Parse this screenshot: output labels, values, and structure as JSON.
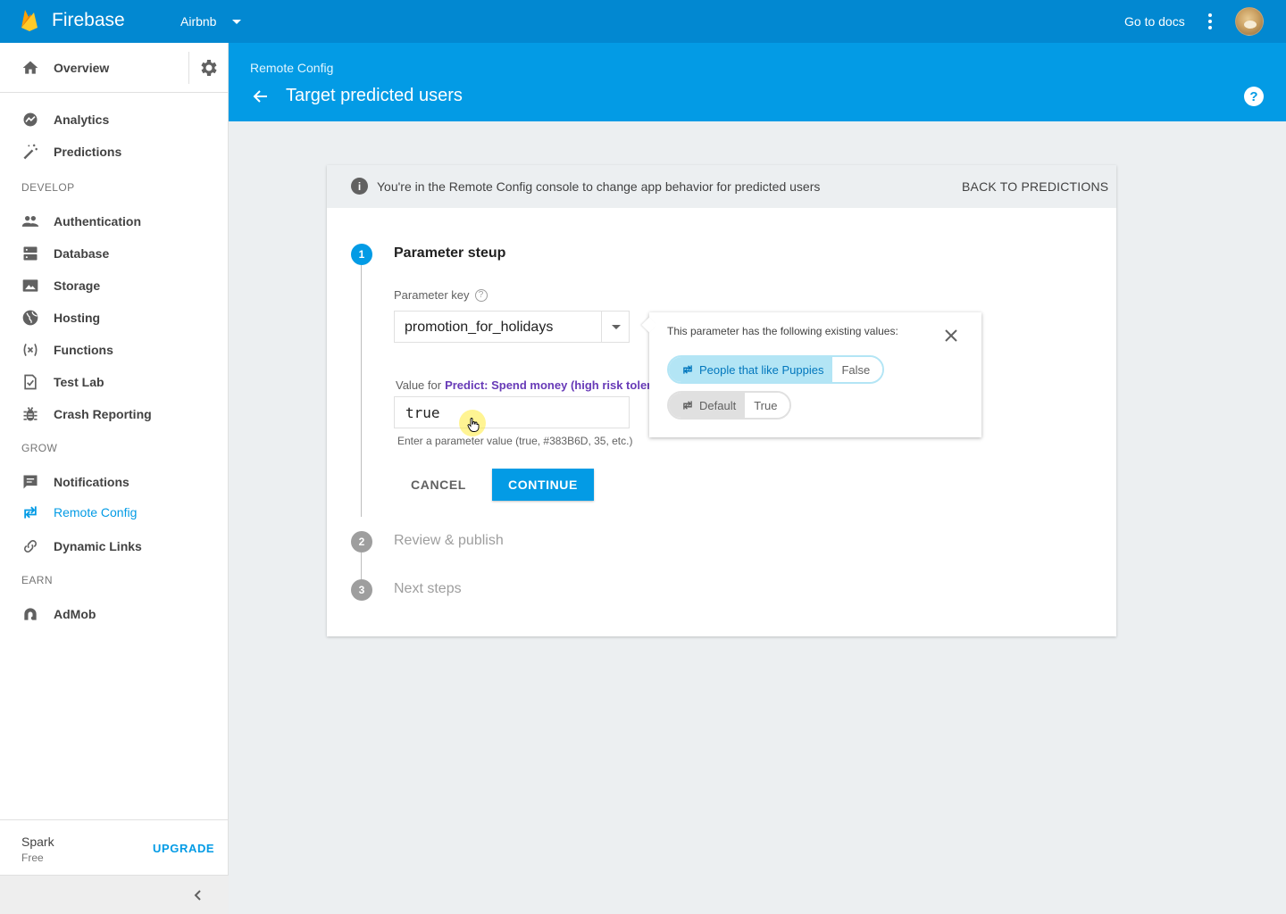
{
  "topbar": {
    "brand": "Firebase",
    "project": "Airbnb",
    "docs_label": "Go to docs"
  },
  "sidebar": {
    "overview": "Overview",
    "items_top": [
      {
        "label": "Analytics",
        "icon": "analytics-icon"
      },
      {
        "label": "Predictions",
        "icon": "magic-wand-icon"
      }
    ],
    "develop_header": "DEVELOP",
    "develop_items": [
      {
        "label": "Authentication",
        "icon": "people-icon"
      },
      {
        "label": "Database",
        "icon": "database-icon"
      },
      {
        "label": "Storage",
        "icon": "storage-icon"
      },
      {
        "label": "Hosting",
        "icon": "globe-icon"
      },
      {
        "label": "Functions",
        "icon": "functions-icon"
      },
      {
        "label": "Test Lab",
        "icon": "checklist-icon"
      },
      {
        "label": "Crash Reporting",
        "icon": "bug-icon"
      }
    ],
    "grow_header": "GROW",
    "grow_items": [
      {
        "label": "Notifications",
        "icon": "chat-icon"
      },
      {
        "label": "Remote Config",
        "icon": "remote-config-icon",
        "active": true
      },
      {
        "label": "Dynamic Links",
        "icon": "link-icon"
      }
    ],
    "earn_header": "EARN",
    "earn_items": [
      {
        "label": "AdMob",
        "icon": "admob-icon"
      }
    ],
    "plan": {
      "name": "Spark",
      "tier": "Free",
      "upgrade": "UPGRADE"
    }
  },
  "page_header": {
    "breadcrumb": "Remote Config",
    "title": "Target predicted users",
    "help": "?"
  },
  "card": {
    "info_text": "You're in the  Remote Config console to change app behavior for predicted users",
    "back_link": "BACK TO PREDICTIONS",
    "steps": [
      {
        "number": "1",
        "title": "Parameter steup",
        "state": "active"
      },
      {
        "number": "2",
        "title": "Review & publish",
        "state": "pending"
      },
      {
        "number": "3",
        "title": "Next steps",
        "state": "pending"
      }
    ],
    "param_key_label": "Parameter key",
    "param_key_value": "promotion_for_holidays",
    "value_for_label": "Value for",
    "value_for_condition": "Predict: Spend money (high risk toleran",
    "value_input": "true",
    "hint": "Enter a parameter value (true, #383B6D, 35, etc.)",
    "cancel": "CANCEL",
    "continue": "CONTINUE"
  },
  "popover": {
    "title": "This parameter has the following existing values:",
    "values": [
      {
        "condition": "People that like Puppies",
        "value": "False"
      },
      {
        "condition": "Default",
        "value": "True"
      }
    ]
  },
  "colors": {
    "topbar": "#0288d1",
    "header": "#039be5",
    "accent": "#039be5",
    "condition_text": "#673ab7"
  }
}
